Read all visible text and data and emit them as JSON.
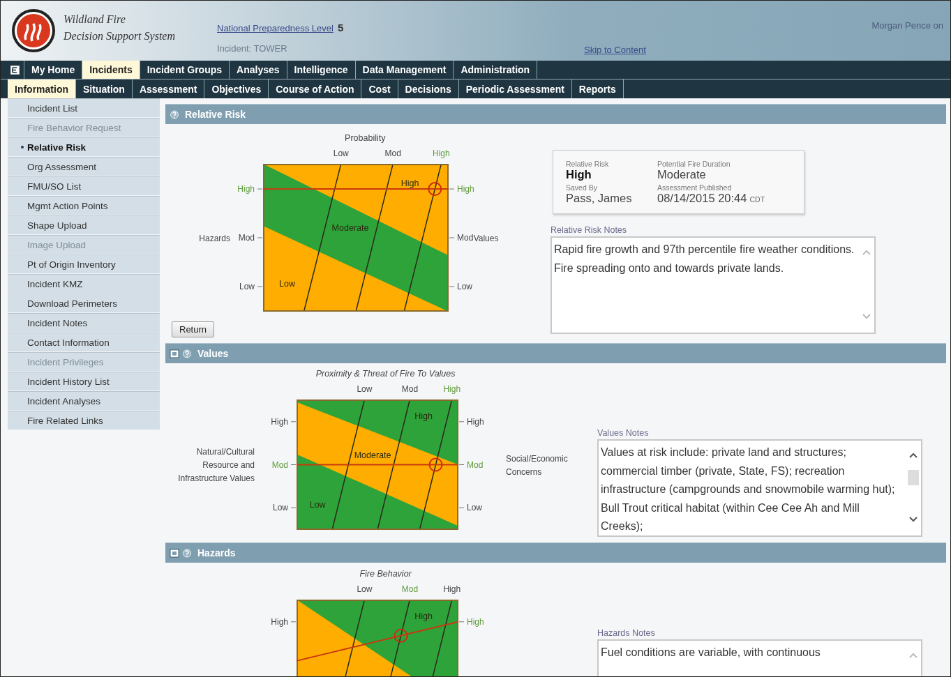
{
  "header": {
    "app_name_line1": "Wildland Fire",
    "app_name_line2": "Decision Support System",
    "preparedness_link": "National Preparedness Level",
    "preparedness_value": "5",
    "incident": "Incident: TOWER",
    "skip_link": "Skip to Content",
    "user": "Morgan Pence on"
  },
  "main_tabs": [
    {
      "label": "My Home",
      "selected": false
    },
    {
      "label": "Incidents",
      "selected": true
    },
    {
      "label": "Incident Groups",
      "selected": false
    },
    {
      "label": "Analyses",
      "selected": false
    },
    {
      "label": "Intelligence",
      "selected": false
    },
    {
      "label": "Data Management",
      "selected": false
    },
    {
      "label": "Administration",
      "selected": false
    }
  ],
  "sub_tabs": [
    {
      "label": "Information",
      "selected": true
    },
    {
      "label": "Situation",
      "selected": false
    },
    {
      "label": "Assessment",
      "selected": false
    },
    {
      "label": "Objectives",
      "selected": false
    },
    {
      "label": "Course of Action",
      "selected": false
    },
    {
      "label": "Cost",
      "selected": false
    },
    {
      "label": "Decisions",
      "selected": false
    },
    {
      "label": "Periodic Assessment",
      "selected": false
    },
    {
      "label": "Reports",
      "selected": false
    }
  ],
  "sidebar": {
    "items": [
      {
        "label": "Incident List",
        "selected": false,
        "disabled": false
      },
      {
        "label": "Fire Behavior Request",
        "selected": false,
        "disabled": true
      },
      {
        "label": "Relative Risk",
        "selected": true,
        "disabled": false
      },
      {
        "label": "Org Assessment",
        "selected": false,
        "disabled": false
      },
      {
        "label": "FMU/SO List",
        "selected": false,
        "disabled": false
      },
      {
        "label": "Mgmt Action Points",
        "selected": false,
        "disabled": false
      },
      {
        "label": "Shape Upload",
        "selected": false,
        "disabled": false
      },
      {
        "label": "Image Upload",
        "selected": false,
        "disabled": true
      },
      {
        "label": "Pt of Origin Inventory",
        "selected": false,
        "disabled": false
      },
      {
        "label": "Incident KMZ",
        "selected": false,
        "disabled": false
      },
      {
        "label": "Download Perimeters",
        "selected": false,
        "disabled": false
      },
      {
        "label": "Incident Notes",
        "selected": false,
        "disabled": false
      },
      {
        "label": "Contact Information",
        "selected": false,
        "disabled": false
      },
      {
        "label": "Incident Privileges",
        "selected": false,
        "disabled": true
      },
      {
        "label": "Incident History List",
        "selected": false,
        "disabled": false
      },
      {
        "label": "Incident Analyses",
        "selected": false,
        "disabled": false
      },
      {
        "label": "Fire Related Links",
        "selected": false,
        "disabled": false
      }
    ]
  },
  "sections": [
    {
      "title": "Relative Risk",
      "collapsible": false,
      "matrix": {
        "kind": "standard",
        "title": "Probability",
        "left_axis": "Hazards",
        "right_axis": "Values",
        "top_ticks": [
          {
            "label": "Low",
            "selected": false
          },
          {
            "label": "Mod",
            "selected": false
          },
          {
            "label": "High",
            "selected": true
          }
        ],
        "left_ticks": [
          {
            "label": "High",
            "selected": true
          },
          {
            "label": "Mod",
            "selected": false
          },
          {
            "label": "Low",
            "selected": false
          }
        ],
        "right_ticks": [
          {
            "label": "High",
            "selected": true
          },
          {
            "label": "Mod",
            "selected": false
          },
          {
            "label": "Low",
            "selected": false
          }
        ],
        "zone_labels": [
          {
            "label": "High",
            "kind": "high"
          },
          {
            "label": "Moderate",
            "kind": "moderate"
          },
          {
            "label": "Low",
            "kind": "low"
          }
        ]
      },
      "return_button": "Return",
      "summary": [
        {
          "label": "Relative Risk",
          "value": "High",
          "emphasized": true
        },
        {
          "label": "Potential Fire Duration",
          "value": "Moderate",
          "emphasized": false
        },
        {
          "label": "Saved By",
          "value": "Pass, James",
          "emphasized": false
        },
        {
          "label": "Assessment Published",
          "value": "08/14/2015 20:44",
          "suffix": "CDT",
          "emphasized": false
        }
      ],
      "notes": {
        "label": "Relative Risk Notes",
        "text": "Rapid fire growth and 97th percentile fire weather conditions. Fire spreading onto and towards private lands."
      }
    },
    {
      "title": "Values",
      "collapsible": true,
      "matrix": {
        "kind": "inverted",
        "title": "Proximity & Threat of Fire To Values",
        "left_axis": "Natural/Cultural Resource and Infrastructure Values",
        "right_axis": "Social/Economic Concerns",
        "top_ticks": [
          {
            "label": "Low",
            "selected": false
          },
          {
            "label": "Mod",
            "selected": false
          },
          {
            "label": "High",
            "selected": true
          }
        ],
        "left_ticks": [
          {
            "label": "High",
            "selected": false
          },
          {
            "label": "Mod",
            "selected": true
          },
          {
            "label": "Low",
            "selected": false
          }
        ],
        "right_ticks": [
          {
            "label": "High",
            "selected": false
          },
          {
            "label": "Mod",
            "selected": true
          },
          {
            "label": "Low",
            "selected": false
          }
        ],
        "zone_labels": [
          {
            "label": "High",
            "kind": "high"
          },
          {
            "label": "Moderate",
            "kind": "moderate"
          },
          {
            "label": "Low",
            "kind": "low"
          }
        ]
      },
      "notes": {
        "label": "Values Notes",
        "text": "Values at risk include: private land and structures; commercial timber (private, State, FS); recreation infrastructure (campgrounds and snowmobile warming hut); Bull Trout critical habitat (within Cee Cee Ah and Mill Creeks);"
      }
    },
    {
      "title": "Hazards",
      "collapsible": true,
      "matrix": {
        "kind": "split",
        "title": "Fire Behavior",
        "top_ticks": [
          {
            "label": "Low",
            "selected": false
          },
          {
            "label": "Mod",
            "selected": true
          },
          {
            "label": "High",
            "selected": false
          }
        ],
        "left_ticks": [
          {
            "label": "High",
            "selected": false
          }
        ],
        "right_ticks": [
          {
            "label": "High",
            "selected": true
          }
        ],
        "zone_labels": [
          {
            "label": "High",
            "kind": "high"
          }
        ]
      },
      "notes": {
        "label": "Hazards Notes",
        "text": "Fuel conditions are variable, with continuous"
      }
    }
  ]
}
